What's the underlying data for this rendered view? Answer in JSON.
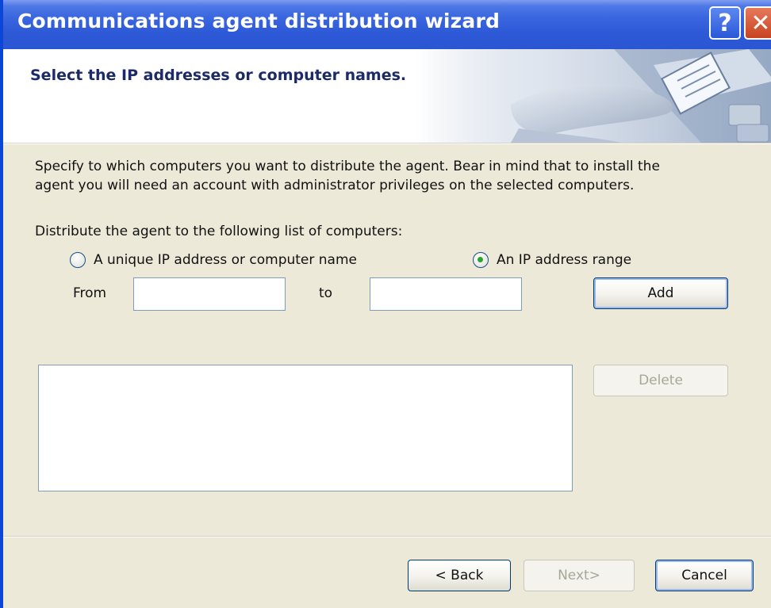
{
  "window": {
    "title": "Communications agent distribution wizard",
    "help_glyph": "?",
    "close_glyph": "✕"
  },
  "header": {
    "title": "Select the IP addresses or computer names."
  },
  "body": {
    "description": "Specify to which computers you want to distribute the agent.  Bear in mind that to install the agent you will need an account with administrator privileges on the selected computers.",
    "distribute_label": "Distribute the agent to the following list of computers:",
    "radio_unique": {
      "label": "A unique IP address or computer name",
      "selected": false
    },
    "radio_range": {
      "label": "An IP address range",
      "selected": true
    },
    "from_label": "From",
    "from_value": "",
    "to_label": "to",
    "to_value": "",
    "add_label": "Add",
    "delete_label": "Delete",
    "computers": []
  },
  "footer": {
    "back_label": "< Back",
    "next_label": "Next>",
    "cancel_label": "Cancel"
  },
  "colors": {
    "titlebar": "#2a55d3",
    "dialog_bg": "#ece9d8",
    "header_title": "#1b2a68",
    "radio_dot": "#2ca52c"
  }
}
